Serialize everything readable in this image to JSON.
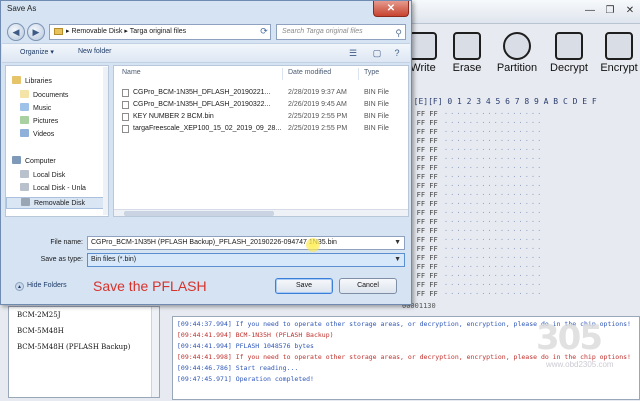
{
  "app": {
    "toolbar": [
      {
        "label": "Write",
        "icon": "write-icon"
      },
      {
        "label": "Erase",
        "icon": "erase-icon"
      },
      {
        "label": "Partition",
        "icon": "partition-icon"
      },
      {
        "label": "Decrypt",
        "icon": "lock-icon"
      },
      {
        "label": "Encrypt",
        "icon": "lock-icon"
      }
    ],
    "hex_header": "D][E][F]  0 1 2 3 4 5 6 7 8 9 A B C D E F",
    "hex_ff": "FF FF FF",
    "address_label": "00001130",
    "device_list": [
      "BCM-2M25J",
      "BCM-5M48H",
      "BCM-5M48H (PFLASH Backup)"
    ],
    "log": [
      {
        "text": "[09:44:37.994]  If you need to operate other storage areas, or decryption, encryption, please do in the chip options!",
        "color": "blue"
      },
      {
        "text": "[09:44:41.994]  BCM-1N35H  (PFLASH Backup)",
        "color": "red"
      },
      {
        "text": "[09:44:41.994]  PFLASH  1048576 bytes",
        "color": "blue"
      },
      {
        "text": "[09:44:41.998]  If you need to operate other storage areas, or decryption, encryption, please do in the chip options!",
        "color": "red"
      },
      {
        "text": "[09:44:46.786]  Start reading...",
        "color": "blue"
      },
      {
        "text": "[09:47:45.971]  Operation completed!",
        "color": "blue"
      }
    ],
    "watermark": {
      "number": "305",
      "url": "www.obd2305.com"
    }
  },
  "dialog": {
    "title": "Save As",
    "breadcrumb": [
      "Removable Disk",
      "Targa original files"
    ],
    "search_placeholder": "Search Targa original files",
    "organize_label": "Organize ▾",
    "new_folder_label": "New folder",
    "nav_items": [
      {
        "label": "Libraries",
        "icon": "library-icon",
        "indent": 0
      },
      {
        "label": "Documents",
        "icon": "documents-icon",
        "indent": 1
      },
      {
        "label": "Music",
        "icon": "music-icon",
        "indent": 1
      },
      {
        "label": "Pictures",
        "icon": "pictures-icon",
        "indent": 1
      },
      {
        "label": "Videos",
        "icon": "videos-icon",
        "indent": 1
      },
      {
        "label": "Computer",
        "icon": "computer-icon",
        "indent": 0
      },
      {
        "label": "Local Disk",
        "icon": "drive-icon",
        "indent": 1
      },
      {
        "label": "Local Disk - Unla",
        "icon": "drive-icon",
        "indent": 1
      },
      {
        "label": "Removable Disk",
        "icon": "usb-drive-icon",
        "indent": 1,
        "selected": true
      }
    ],
    "columns": {
      "name": "Name",
      "date": "Date modified",
      "type": "Type"
    },
    "files": [
      {
        "name": "CGPro_BCM-1N35H_DFLASH_20190221...",
        "date": "2/28/2019 9:37 AM",
        "type": "BIN File"
      },
      {
        "name": "CGPro_BCM-1N35H_DFLASH_20190322...",
        "date": "2/26/2019 9:45 AM",
        "type": "BIN File"
      },
      {
        "name": "KEY NUMBER 2 BCM.bin",
        "date": "2/25/2019 2:55 PM",
        "type": "BIN File"
      },
      {
        "name": "targaFreescale_XEP100_15_02_2019_09_28...",
        "date": "2/25/2019 2:55 PM",
        "type": "BIN File"
      }
    ],
    "file_name_label": "File name:",
    "file_name_value": "CGPro_BCM-1N35H (PFLASH Backup)_PFLASH_20190226-094747 1N35.bin",
    "save_type_label": "Save as type:",
    "save_type_value": "Bin files (*.bin)",
    "hide_folders_label": "Hide Folders",
    "annotation": "Save the PFLASH",
    "save_label": "Save",
    "cancel_label": "Cancel",
    "accent_color": "#d8322a"
  }
}
